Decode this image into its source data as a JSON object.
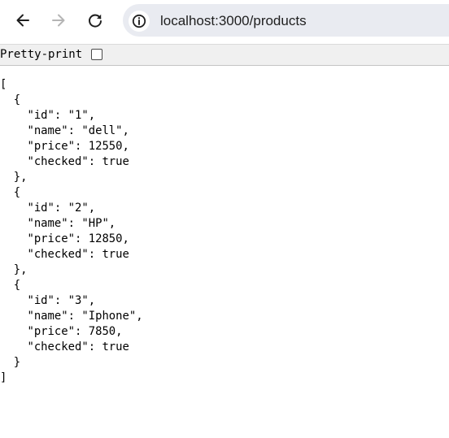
{
  "browser": {
    "url": "localhost:3000/products",
    "back_icon": "arrow-left-icon",
    "forward_icon": "arrow-right-icon",
    "reload_icon": "reload-icon",
    "site_info_icon": "info-icon"
  },
  "json_viewer": {
    "pretty_print_label": "Pretty-print",
    "pretty_print_checked": false,
    "lines": [
      "[",
      "  {",
      "    \"id\": \"1\",",
      "    \"name\": \"dell\",",
      "    \"price\": 12550,",
      "    \"checked\": true",
      "  },",
      "  {",
      "    \"id\": \"2\",",
      "    \"name\": \"HP\",",
      "    \"price\": 12850,",
      "    \"checked\": true",
      "  },",
      "  {",
      "    \"id\": \"3\",",
      "    \"name\": \"Iphone\",",
      "    \"price\": 7850,",
      "    \"checked\": true",
      "  }",
      "]"
    ]
  }
}
